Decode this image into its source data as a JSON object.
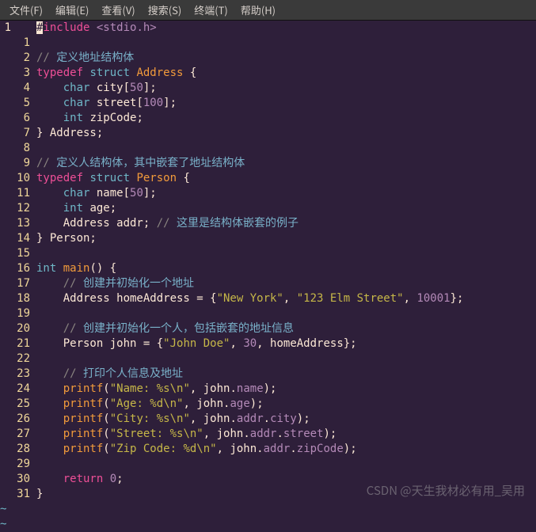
{
  "menubar": {
    "file": "文件(F)",
    "edit": "编辑(E)",
    "view": "查看(V)",
    "search": "搜索(S)",
    "terminal": "终端(T)",
    "help": "帮助(H)"
  },
  "left_label": "1",
  "gutter": [
    "",
    "1",
    "2",
    "3",
    "4",
    "5",
    "6",
    "7",
    "8",
    "9",
    "10",
    "11",
    "12",
    "13",
    "14",
    "15",
    "16",
    "17",
    "18",
    "19",
    "20",
    "21",
    "22",
    "23",
    "24",
    "25",
    "26",
    "27",
    "28",
    "29",
    "30",
    "31"
  ],
  "code_lines": [
    [
      {
        "c": "cursor",
        "t": "#"
      },
      {
        "c": "mg",
        "t": "include "
      },
      {
        "c": "an",
        "t": "<stdio.h>"
      }
    ],
    [],
    [
      {
        "c": "gr",
        "t": "// "
      },
      {
        "c": "cm",
        "t": "定义地址结构体"
      }
    ],
    [
      {
        "c": "mg",
        "t": "typedef "
      },
      {
        "c": "bl",
        "t": "struct"
      },
      {
        "c": "pl",
        "t": " "
      },
      {
        "c": "or",
        "t": "Address"
      },
      {
        "c": "pl",
        "t": " {"
      }
    ],
    [
      {
        "c": "pl",
        "t": "    "
      },
      {
        "c": "bl",
        "t": "char"
      },
      {
        "c": "pl",
        "t": " city["
      },
      {
        "c": "nu",
        "t": "50"
      },
      {
        "c": "pl",
        "t": "];"
      }
    ],
    [
      {
        "c": "pl",
        "t": "    "
      },
      {
        "c": "bl",
        "t": "char"
      },
      {
        "c": "pl",
        "t": " street["
      },
      {
        "c": "nu",
        "t": "100"
      },
      {
        "c": "pl",
        "t": "];"
      }
    ],
    [
      {
        "c": "pl",
        "t": "    "
      },
      {
        "c": "bl",
        "t": "int"
      },
      {
        "c": "pl",
        "t": " zipCode;"
      }
    ],
    [
      {
        "c": "pl",
        "t": "} Address;"
      }
    ],
    [],
    [
      {
        "c": "gr",
        "t": "// "
      },
      {
        "c": "cm",
        "t": "定义人结构体，其中嵌套了地址结构体"
      }
    ],
    [
      {
        "c": "mg",
        "t": "typedef "
      },
      {
        "c": "bl",
        "t": "struct"
      },
      {
        "c": "pl",
        "t": " "
      },
      {
        "c": "or",
        "t": "Person"
      },
      {
        "c": "pl",
        "t": " {"
      }
    ],
    [
      {
        "c": "pl",
        "t": "    "
      },
      {
        "c": "bl",
        "t": "char"
      },
      {
        "c": "pl",
        "t": " name["
      },
      {
        "c": "nu",
        "t": "50"
      },
      {
        "c": "pl",
        "t": "];"
      }
    ],
    [
      {
        "c": "pl",
        "t": "    "
      },
      {
        "c": "bl",
        "t": "int"
      },
      {
        "c": "pl",
        "t": " age;"
      }
    ],
    [
      {
        "c": "pl",
        "t": "    Address addr; "
      },
      {
        "c": "gr",
        "t": "// "
      },
      {
        "c": "cm",
        "t": "这里是结构体嵌套的例子"
      }
    ],
    [
      {
        "c": "pl",
        "t": "} Person;"
      }
    ],
    [],
    [
      {
        "c": "bl",
        "t": "int"
      },
      {
        "c": "pl",
        "t": " "
      },
      {
        "c": "or",
        "t": "main"
      },
      {
        "c": "pl",
        "t": "() {"
      }
    ],
    [
      {
        "c": "pl",
        "t": "    "
      },
      {
        "c": "gr",
        "t": "// "
      },
      {
        "c": "cm",
        "t": "创建并初始化一个地址"
      }
    ],
    [
      {
        "c": "pl",
        "t": "    Address homeAddress = {"
      },
      {
        "c": "st",
        "t": "\"New York\""
      },
      {
        "c": "pl",
        "t": ", "
      },
      {
        "c": "st",
        "t": "\"123 Elm Street\""
      },
      {
        "c": "pl",
        "t": ", "
      },
      {
        "c": "nu",
        "t": "10001"
      },
      {
        "c": "pl",
        "t": "};"
      }
    ],
    [],
    [
      {
        "c": "pl",
        "t": "    "
      },
      {
        "c": "gr",
        "t": "// "
      },
      {
        "c": "cm",
        "t": "创建并初始化一个人，包括嵌套的地址信息"
      }
    ],
    [
      {
        "c": "pl",
        "t": "    Person john = {"
      },
      {
        "c": "st",
        "t": "\"John Doe\""
      },
      {
        "c": "pl",
        "t": ", "
      },
      {
        "c": "nu",
        "t": "30"
      },
      {
        "c": "pl",
        "t": ", homeAddress};"
      }
    ],
    [],
    [
      {
        "c": "pl",
        "t": "    "
      },
      {
        "c": "gr",
        "t": "// "
      },
      {
        "c": "cm",
        "t": "打印个人信息及地址"
      }
    ],
    [
      {
        "c": "pl",
        "t": "    "
      },
      {
        "c": "or",
        "t": "printf"
      },
      {
        "c": "pl",
        "t": "("
      },
      {
        "c": "st",
        "t": "\"Name: %s\\n\""
      },
      {
        "c": "pl",
        "t": ", john."
      },
      {
        "c": "pu",
        "t": "name"
      },
      {
        "c": "pl",
        "t": ");"
      }
    ],
    [
      {
        "c": "pl",
        "t": "    "
      },
      {
        "c": "or",
        "t": "printf"
      },
      {
        "c": "pl",
        "t": "("
      },
      {
        "c": "st",
        "t": "\"Age: %d\\n\""
      },
      {
        "c": "pl",
        "t": ", john."
      },
      {
        "c": "pu",
        "t": "age"
      },
      {
        "c": "pl",
        "t": ");"
      }
    ],
    [
      {
        "c": "pl",
        "t": "    "
      },
      {
        "c": "or",
        "t": "printf"
      },
      {
        "c": "pl",
        "t": "("
      },
      {
        "c": "st",
        "t": "\"City: %s\\n\""
      },
      {
        "c": "pl",
        "t": ", john."
      },
      {
        "c": "pu",
        "t": "addr"
      },
      {
        "c": "pl",
        "t": "."
      },
      {
        "c": "pu",
        "t": "city"
      },
      {
        "c": "pl",
        "t": ");"
      }
    ],
    [
      {
        "c": "pl",
        "t": "    "
      },
      {
        "c": "or",
        "t": "printf"
      },
      {
        "c": "pl",
        "t": "("
      },
      {
        "c": "st",
        "t": "\"Street: %s\\n\""
      },
      {
        "c": "pl",
        "t": ", john."
      },
      {
        "c": "pu",
        "t": "addr"
      },
      {
        "c": "pl",
        "t": "."
      },
      {
        "c": "pu",
        "t": "street"
      },
      {
        "c": "pl",
        "t": ");"
      }
    ],
    [
      {
        "c": "pl",
        "t": "    "
      },
      {
        "c": "or",
        "t": "printf"
      },
      {
        "c": "pl",
        "t": "("
      },
      {
        "c": "st",
        "t": "\"Zip Code: %d\\n\""
      },
      {
        "c": "pl",
        "t": ", john."
      },
      {
        "c": "pu",
        "t": "addr"
      },
      {
        "c": "pl",
        "t": "."
      },
      {
        "c": "pu",
        "t": "zipCode"
      },
      {
        "c": "pl",
        "t": ");"
      }
    ],
    [],
    [
      {
        "c": "pl",
        "t": "    "
      },
      {
        "c": "mg",
        "t": "return"
      },
      {
        "c": "pl",
        "t": " "
      },
      {
        "c": "nu",
        "t": "0"
      },
      {
        "c": "pl",
        "t": ";"
      }
    ],
    [
      {
        "c": "pl",
        "t": "}"
      }
    ]
  ],
  "tilde": "~",
  "watermark": "CSDN @天生我材必有用_吴用"
}
